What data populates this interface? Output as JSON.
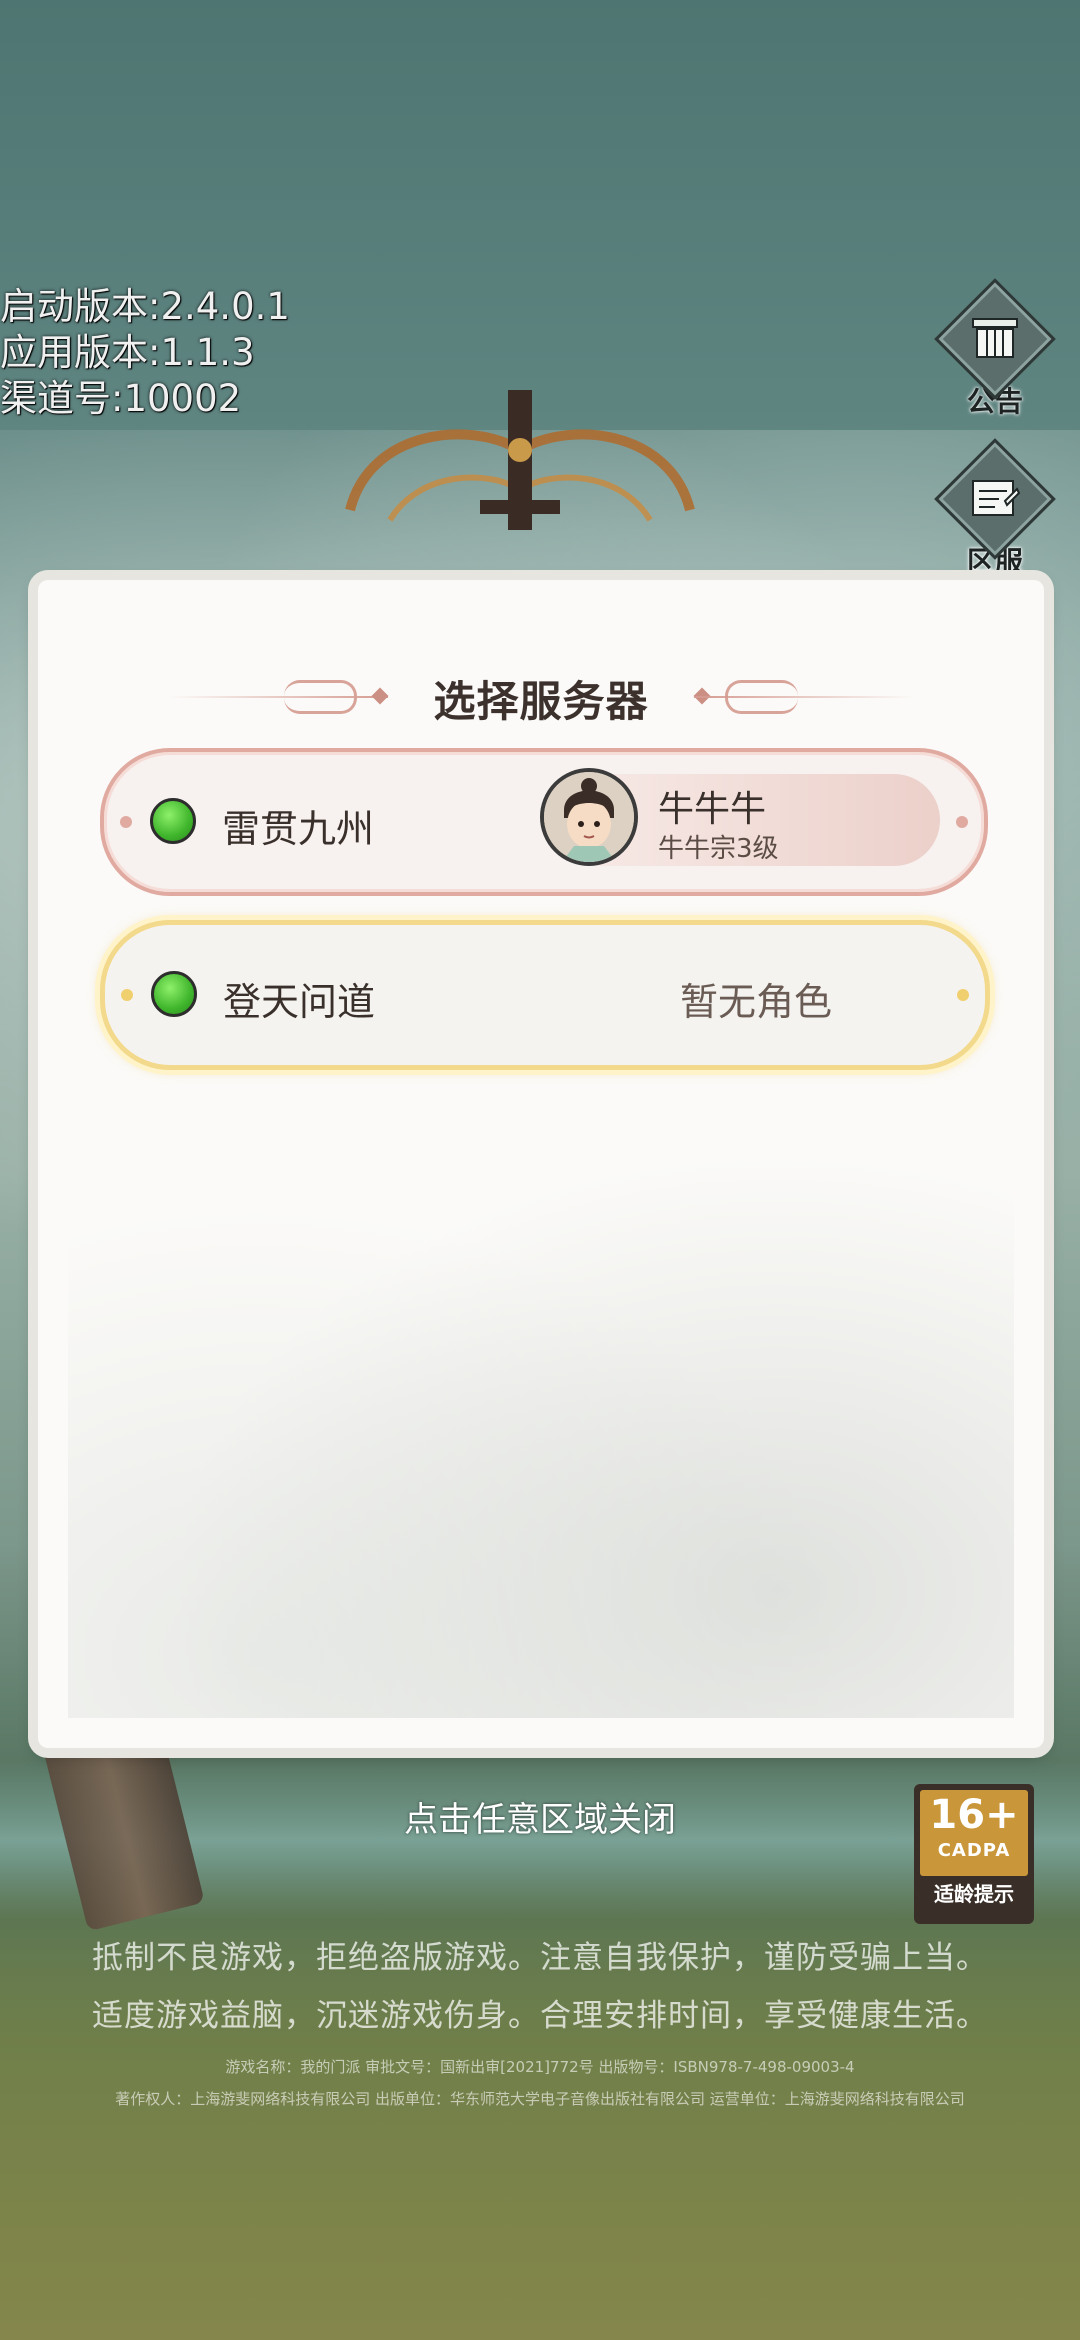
{
  "version_info": {
    "launch_version": "启动版本:2.4.0.1",
    "app_version": "应用版本:1.1.3",
    "channel": "渠道号:10002"
  },
  "side_buttons": {
    "announcement": "公告",
    "server_zone": "区服"
  },
  "dialog": {
    "title": "选择服务器",
    "servers": [
      {
        "name": "雷贯九州",
        "status": "online",
        "role_name": "牛牛牛",
        "role_sect": "牛牛宗3级"
      },
      {
        "name": "登天问道",
        "status": "online",
        "no_role": "暂无角色"
      }
    ]
  },
  "close_hint": "点击任意区域关闭",
  "age_rating": {
    "age": "16+",
    "org": "CADPA",
    "tip": "适龄提示"
  },
  "health_notice": {
    "line1": "抵制不良游戏，拒绝盗版游戏。注意自我保护，谨防受骗上当。",
    "line2": "适度游戏益脑，沉迷游戏伤身。合理安排时间，享受健康生活。"
  },
  "publication": {
    "line1": "游戏名称：我的门派 审批文号：国新出审[2021]772号 出版物号：ISBN978-7-498-09003-4",
    "line2": "著作权人：上海游斐网络科技有限公司 出版单位：华东师范大学电子音像出版社有限公司 运营单位：上海游斐网络科技有限公司"
  },
  "colors": {
    "online_green": "#3fb52c",
    "selected_border": "#f2d98b",
    "current_border": "#e0aaa1"
  }
}
